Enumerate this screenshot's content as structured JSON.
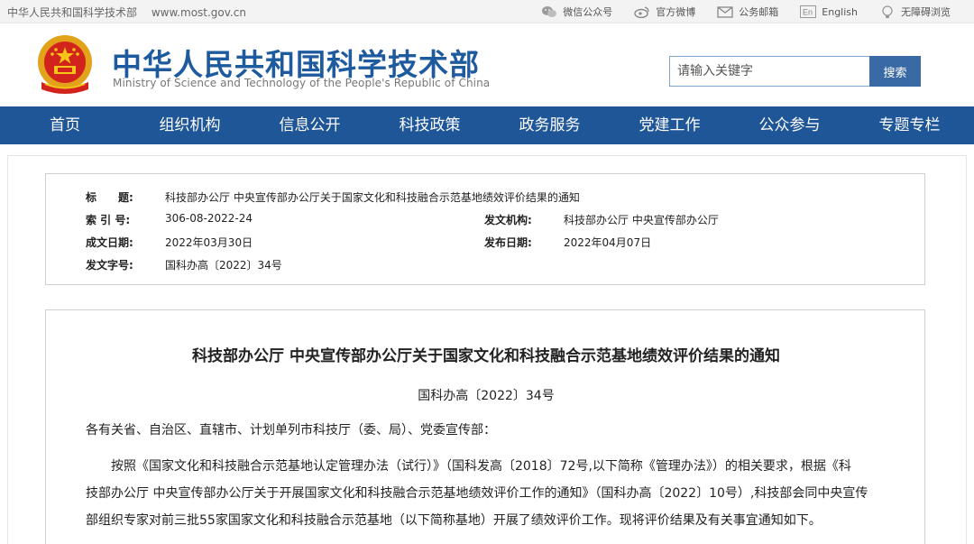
{
  "topbar": {
    "site_name": "中华人民共和国科学技术部",
    "site_url": "www.most.gov.cn",
    "links": [
      {
        "label": "微信公众号",
        "icon": "wechat-icon"
      },
      {
        "label": "官方微博",
        "icon": "weibo-icon"
      },
      {
        "label": "公务邮箱",
        "icon": "mail-icon"
      },
      {
        "label": "English",
        "icon": "english-icon"
      },
      {
        "label": "无障碍浏览",
        "icon": "accessibility-icon"
      }
    ]
  },
  "header": {
    "title_cn": "中华人民共和国科学技术部",
    "title_en": "Ministry of Science and Technology of the People's Republic of China",
    "logo": "national-emblem-icon",
    "search": {
      "placeholder": "请输入关键字",
      "button": "搜索"
    }
  },
  "nav": {
    "items": [
      "首页",
      "组织机构",
      "信息公开",
      "科技政策",
      "政务服务",
      "党建工作",
      "公众参与",
      "专题专栏"
    ]
  },
  "meta": {
    "title_label": "标　　题:",
    "title_value": "科技部办公厅 中央宣传部办公厅关于国家文化和科技融合示范基地绩效评价结果的通知",
    "index_label": "索 引 号:",
    "index_value": "306-08-2022-24",
    "issuer_label": "发文机构:",
    "issuer_value": "科技部办公厅 中央宣传部办公厅",
    "created_label": "成文日期:",
    "created_value": "2022年03月30日",
    "published_label": "发布日期:",
    "published_value": "2022年04月07日",
    "docno_label": "发文字号:",
    "docno_value": "国科办高〔2022〕34号"
  },
  "article": {
    "title": "科技部办公厅 中央宣传部办公厅关于国家文化和科技融合示范基地绩效评价结果的通知",
    "doc_number": "国科办高〔2022〕34号",
    "salutation": "各有关省、自治区、直辖市、计划单列市科技厅（委、局）、党委宣传部：",
    "para1": [
      "按照《国家文化和科技融合示范基地认定管理办法（试行）》（国科发高〔2018〕72号,以下简称《管理办法》）的相关要求，根据《科",
      "技部办公厅 中央宣传部办公厅关于开展国家文化和科技融合示范基地绩效评价工作的通知》（国科办高〔2022〕10号）,科技部会同中央宣传",
      "部组织专家对前三批55家国家文化和科技融合示范基地（以下简称基地）开展了绩效评价工作。现将评价结果及有关事宜通知如下。"
    ]
  },
  "colors": {
    "brand_blue": "#1e5a9e",
    "nav_bg": "#1f5698",
    "search_button": "#3a6aa5"
  }
}
